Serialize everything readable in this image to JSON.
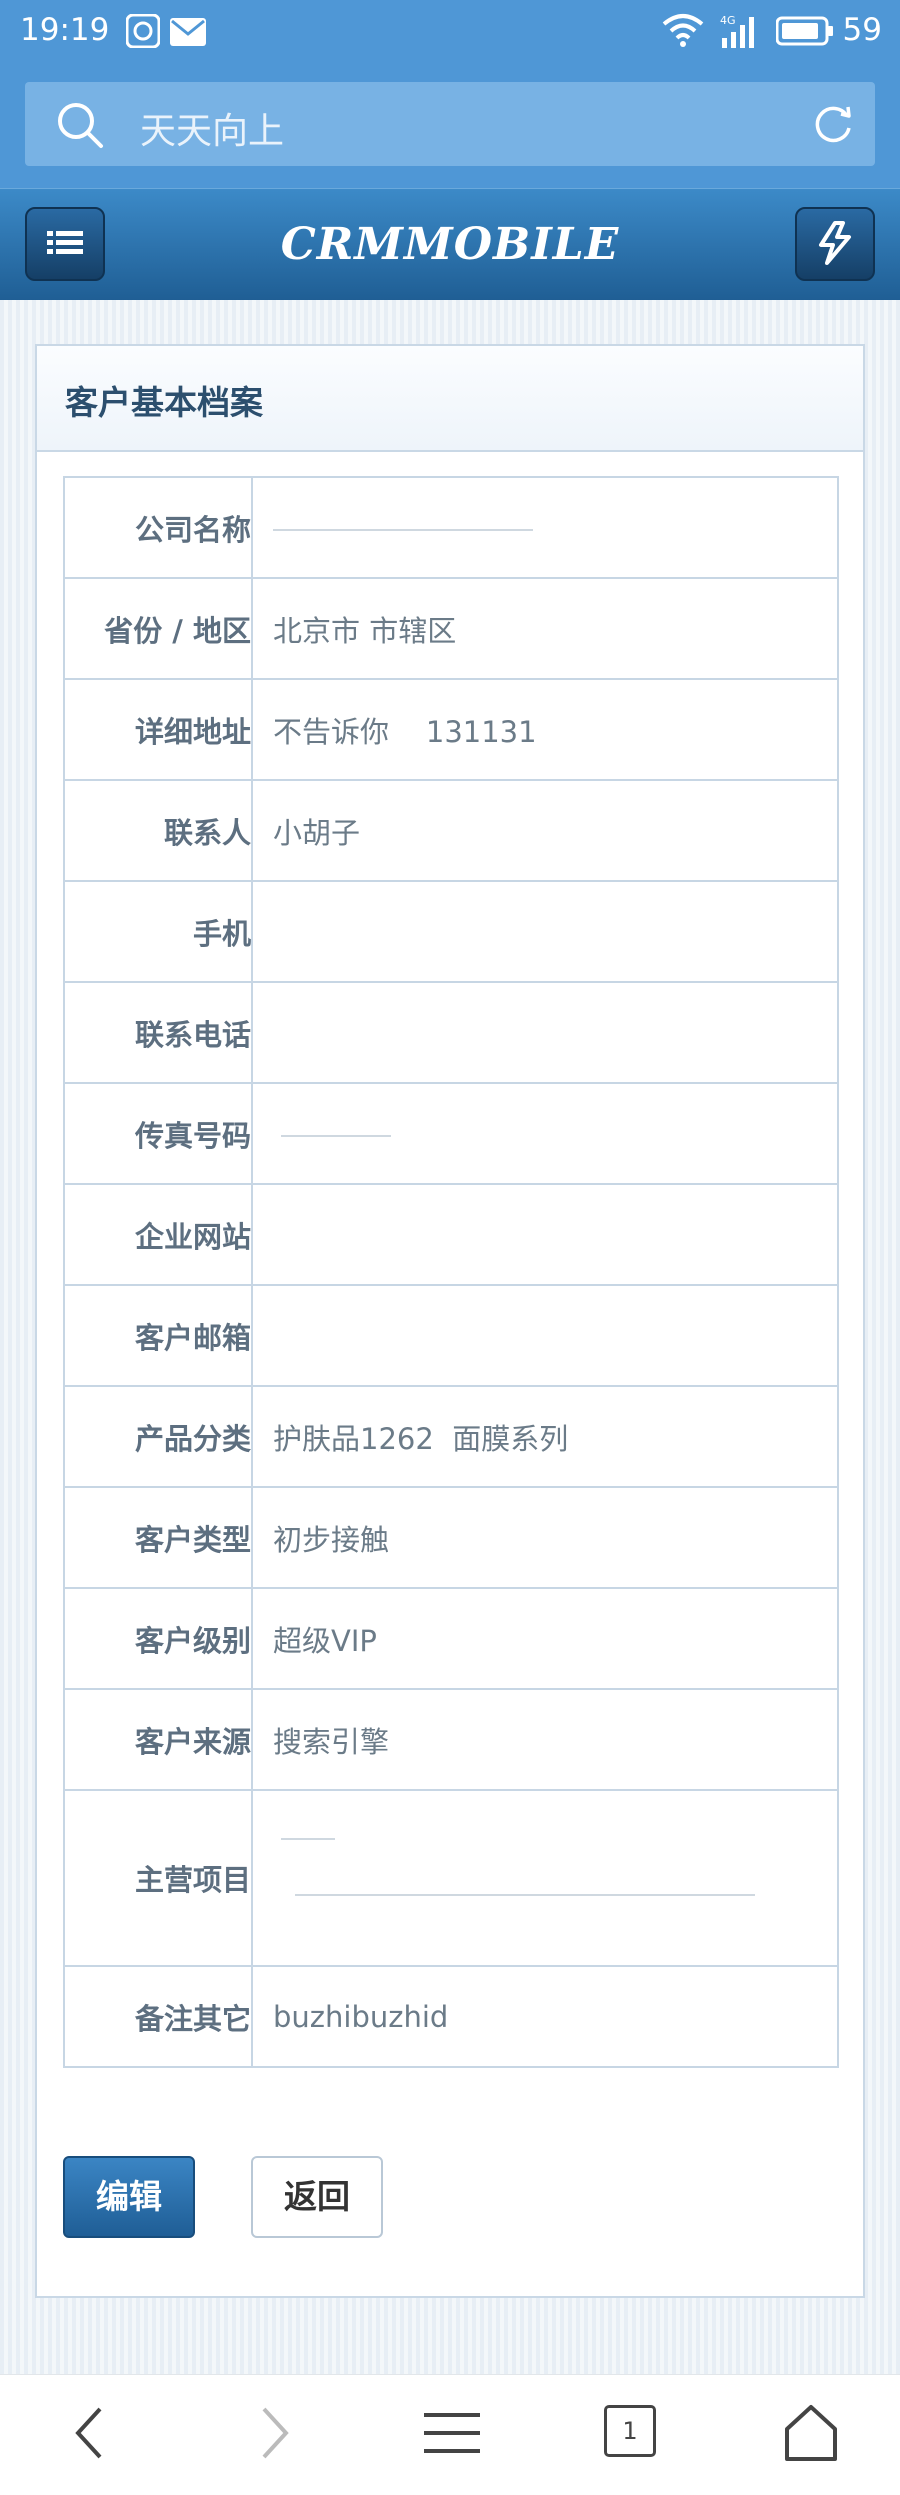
{
  "status": {
    "time": "19:19",
    "battery": "59",
    "network": "4G"
  },
  "search": {
    "text": "天天向上"
  },
  "app": {
    "title": "CRMMOBILE"
  },
  "panel": {
    "title": "客户基本档案"
  },
  "rows": [
    {
      "label": "公司名称",
      "value": ""
    },
    {
      "label": "省份 / 地区",
      "value": "北京市  市辖区"
    },
    {
      "label": "详细地址",
      "value": "不告诉你    131131"
    },
    {
      "label": "联系人",
      "value": "小胡子"
    },
    {
      "label": "手机",
      "value": ""
    },
    {
      "label": "联系电话",
      "value": ""
    },
    {
      "label": "传真号码",
      "value": ""
    },
    {
      "label": "企业网站",
      "value": ""
    },
    {
      "label": "客户邮箱",
      "value": ""
    },
    {
      "label": "产品分类",
      "value": "护肤品1262  面膜系列"
    },
    {
      "label": "客户类型",
      "value": "初步接触"
    },
    {
      "label": "客户级别",
      "value": "超级VIP"
    },
    {
      "label": "客户来源",
      "value": "搜索引擎"
    },
    {
      "label": "主营项目",
      "value": ""
    },
    {
      "label": "备注其它",
      "value": "buzhibuzhid"
    }
  ],
  "buttons": {
    "edit": "编辑",
    "back": "返回"
  },
  "nav": {
    "tab_count": "1"
  },
  "colors": {
    "primary": "#2a6aa3",
    "statusbar": "#4f97d6",
    "border": "#c7d6e4"
  }
}
